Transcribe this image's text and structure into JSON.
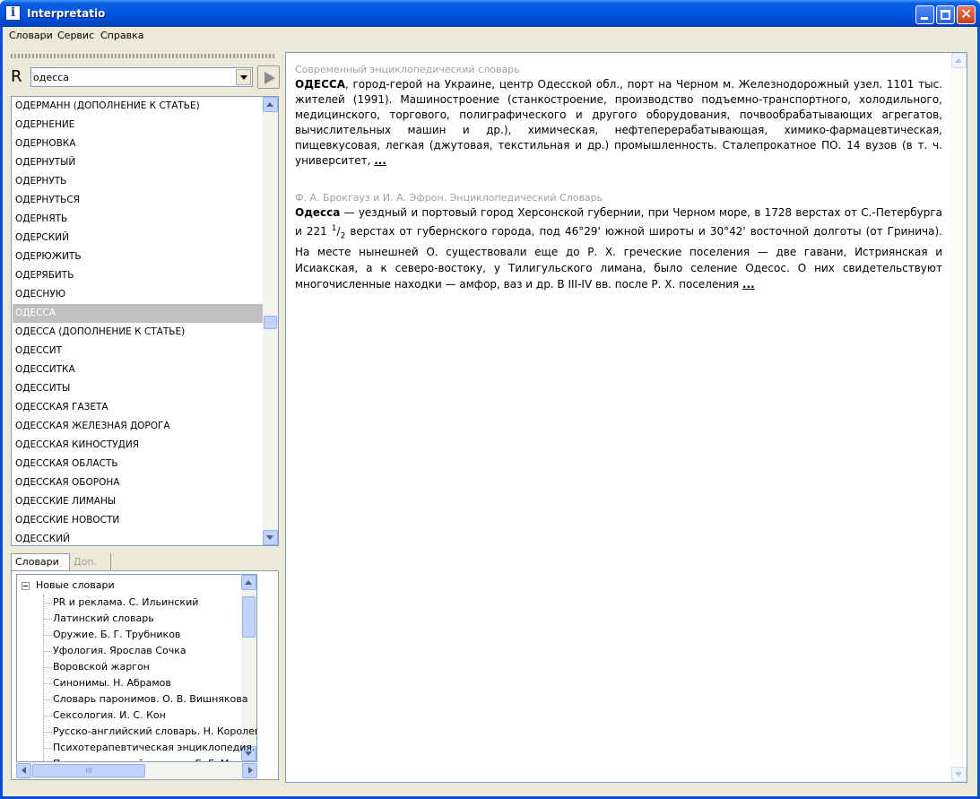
{
  "window": {
    "title": "Interpretatio",
    "icon_glyph": "i"
  },
  "menu": [
    "Словари",
    "Сервис",
    "Справка"
  ],
  "search": {
    "prefix": "R",
    "query": "одесса"
  },
  "words": [
    "ОДЕРМАНН (ДОПОЛНЕНИЕ К СТАТЬЕ)",
    "ОДЕРНЕНИЕ",
    "ОДЕРНОВКА",
    "ОДЕРНУТЫЙ",
    "ОДЕРНУТЬ",
    "ОДЕРНУТЬСЯ",
    "ОДЕРНЯТЬ",
    "ОДЕРСКИЙ",
    "ОДЕРЮЖИТЬ",
    "ОДЕРЯБИТЬ",
    "ОДЕСНУЮ",
    "ОДЕССА",
    "ОДЕССА (ДОПОЛНЕНИЕ К СТАТЬЕ)",
    "ОДЕССИТ",
    "ОДЕССИТКА",
    "ОДЕССИТЫ",
    "ОДЕССКАЯ ГАЗЕТА",
    "ОДЕССКАЯ ЖЕЛЕЗНАЯ ДОРОГА",
    "ОДЕССКАЯ КИНОСТУДИЯ",
    "ОДЕССКАЯ ОБЛАСТЬ",
    "ОДЕССКАЯ ОБОРОНА",
    "ОДЕССКИЕ ЛИМАНЫ",
    "ОДЕССКИЕ НОВОСТИ",
    "ОДЕССКИЙ"
  ],
  "selected_word_index": 11,
  "tabs": {
    "dictionaries": "Словари",
    "extra": "Доп."
  },
  "tree": {
    "root": "Новые словари",
    "children": [
      "PR и реклама. С. Ильинский",
      "Латинский словарь",
      "Оружие. Б. Г. Трубников",
      "Уфология. Ярослав Сочка",
      "Воровской жаргон",
      "Синонимы. Н. Абрамов",
      "Словарь паронимов. О. В. Вишнякова",
      "Сексология. И. С. Кон",
      "Русско-английский словарь. Н. Королев",
      "Психотерапевтическая энциклопедия.",
      "Психологический словарь. Б. Г. Мещеряк"
    ]
  },
  "hscroll_grip": "III",
  "articles": [
    {
      "source": "Современный энциклопедический словарь",
      "headword": "ОДЕССА",
      "text": ", город-герой на Украине, центр Одесской обл., порт на Черном м. Железнодорожный узел. 1101 тыс. жителей (1991). Машиностроение (станкостроение, производство подъемно-транспортного, холодильного, медицинского, торгового, полиграфического и другого оборудования, почвообрабатывающих агрегатов, вычислительных машин и др.), химическая, нефтеперерабатывающая, химико-фармацевтическая, пищевкусовая, легкая (джутовая, текстильная и др.) промышленность. Сталепрокатное ПО. 14 вузов (в т. ч. университет, ",
      "more": "..."
    },
    {
      "source": "Ф. А. Брокгауз и И. А. Эфрон. Энциклопедический Словарь",
      "headword": "Одесса",
      "text_a": " — уездный и портовый город Херсонской губернии, при Черном море, в 1728 верстах от С.-Петербурга и 221 ",
      "frac_num": "1",
      "frac_den": "2",
      "text_b": " верстах от губернского города, под 46°29' южной широты и 30°42' восточной долготы (от Гринича). На месте нынешней О. существовали еще до Р. Х. греческие поселения — две гавани, Истриянская и Исиакская, а к северо-востоку, у Тилигульского лимана, было селение Одесос. О них свидетельствуют многочисленные находки — амфор, ваз и др. В III-IV вв. после Р. Х. поселения ",
      "more": "..."
    }
  ]
}
